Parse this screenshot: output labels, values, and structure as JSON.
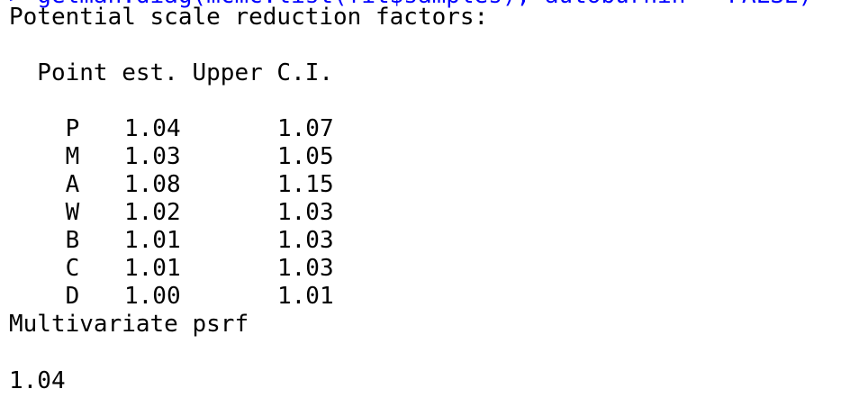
{
  "console": {
    "command_fragment": "> gelman.diag(mcmc.list(fit$samples), autoburnin = FALSE)",
    "title": "Potential scale reduction factors:",
    "header": "  Point est. Upper C.I.",
    "rows": [
      {
        "name": "P",
        "point": "1.04",
        "upper": "1.07"
      },
      {
        "name": "M",
        "point": "1.03",
        "upper": "1.05"
      },
      {
        "name": "A",
        "point": "1.08",
        "upper": "1.15"
      },
      {
        "name": "W",
        "point": "1.02",
        "upper": "1.03"
      },
      {
        "name": "B",
        "point": "1.01",
        "upper": "1.03"
      },
      {
        "name": "C",
        "point": "1.01",
        "upper": "1.03"
      },
      {
        "name": "D",
        "point": "1.00",
        "upper": "1.01"
      }
    ],
    "multivariate_label": "Multivariate psrf",
    "multivariate_value": "1.04"
  },
  "colors": {
    "background": "#ffffff",
    "output_text": "#000000",
    "command_text": "#0000ff"
  }
}
